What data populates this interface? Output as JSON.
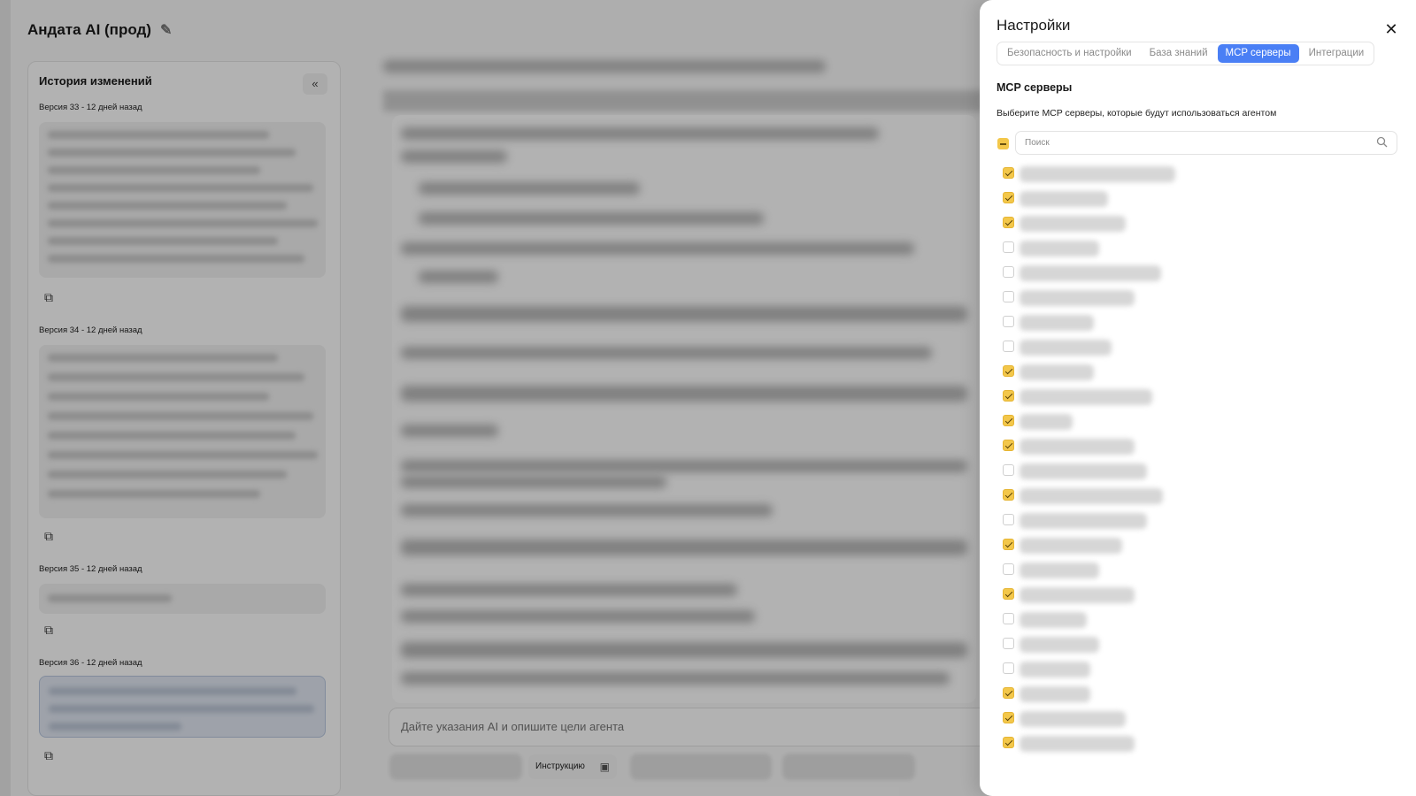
{
  "app": {
    "title": "Андата AI (прод)",
    "history": {
      "title": "История изменений",
      "collapse_label": "«",
      "versions": [
        {
          "label": "Версия 33 - 12 дней назад"
        },
        {
          "label": "Версия 34 - 12 дней назад"
        },
        {
          "label": "Версия 35 - 12 дней назад"
        },
        {
          "label": "Версия 36 - 12 дней назад"
        }
      ]
    },
    "prompt": {
      "placeholder": "Дайте указания AI и опишите цели агента"
    },
    "instructions_button": "Инструкцию"
  },
  "settings": {
    "title": "Настройки",
    "close_label": "✕",
    "tabs": [
      {
        "label": "Безопасность и настройки",
        "active": false
      },
      {
        "label": "База знаний",
        "active": false
      },
      {
        "label": "MCP серверы",
        "active": true
      },
      {
        "label": "Интеграции",
        "active": false
      }
    ],
    "section_title": "MCP серверы",
    "section_description": "Выберите MCP серверы, которые будут использоваться агентом",
    "search_placeholder": "Поиск",
    "servers": [
      {
        "checked": true
      },
      {
        "checked": true
      },
      {
        "checked": true
      },
      {
        "checked": false
      },
      {
        "checked": false
      },
      {
        "checked": false
      },
      {
        "checked": false
      },
      {
        "checked": false
      },
      {
        "checked": true
      },
      {
        "checked": true
      },
      {
        "checked": true
      },
      {
        "checked": true
      },
      {
        "checked": false
      },
      {
        "checked": true
      },
      {
        "checked": false
      },
      {
        "checked": true
      },
      {
        "checked": false
      },
      {
        "checked": true
      },
      {
        "checked": false
      },
      {
        "checked": false
      },
      {
        "checked": false
      },
      {
        "checked": true
      },
      {
        "checked": true
      },
      {
        "checked": true
      }
    ]
  },
  "colors": {
    "accent_tab": "#4a7ff5",
    "checkbox_checked": "#f3c74a"
  },
  "icons": {
    "edit": "pencil-icon",
    "copy": "copy-icon",
    "close": "close-icon",
    "search": "search-icon",
    "save": "save-icon"
  }
}
